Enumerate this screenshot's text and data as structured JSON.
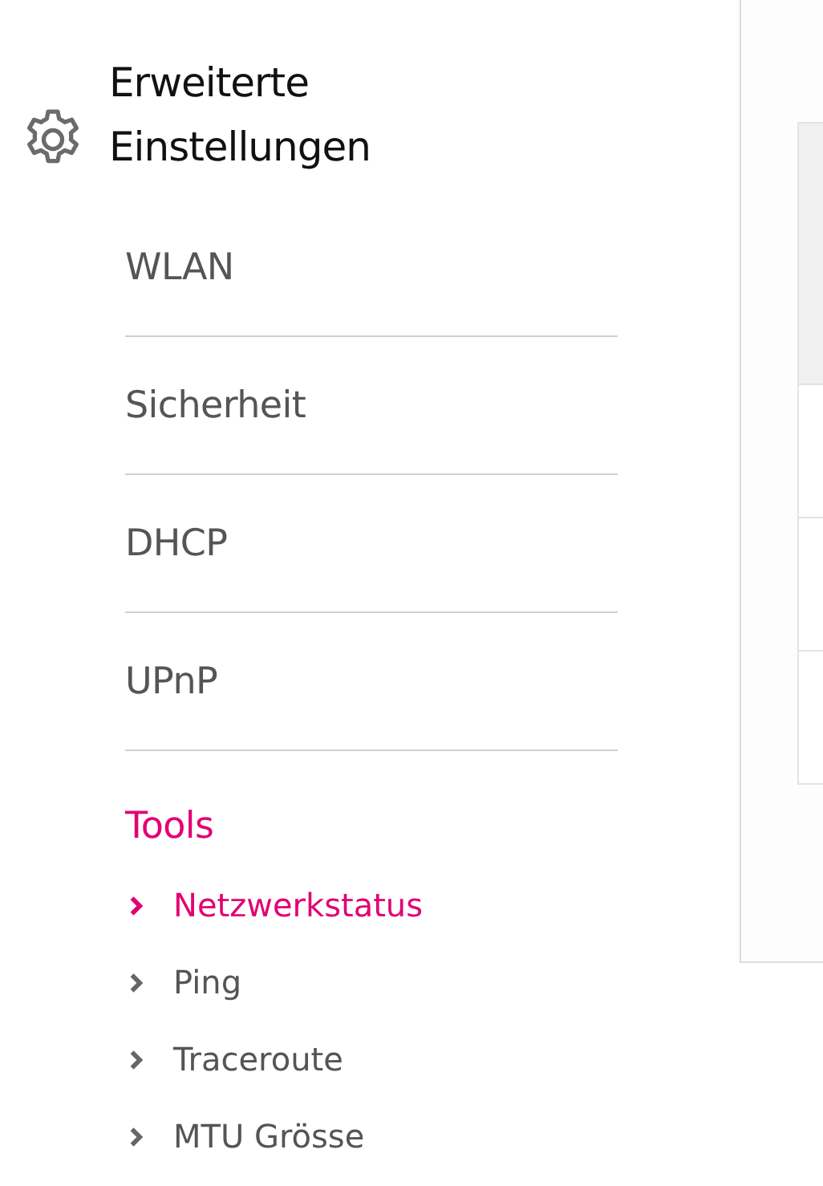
{
  "sidebar": {
    "title_line_1": "Erweiterte",
    "title_line_2": "Einstellungen",
    "items": [
      {
        "label": "WLAN"
      },
      {
        "label": "Sicherheit"
      },
      {
        "label": "DHCP"
      },
      {
        "label": "UPnP"
      }
    ],
    "tools": {
      "heading": "Tools",
      "items": [
        {
          "label": "Netzwerkstatus",
          "selected": true
        },
        {
          "label": "Ping",
          "selected": false
        },
        {
          "label": "Traceroute",
          "selected": false
        },
        {
          "label": "MTU Grösse",
          "selected": false
        }
      ]
    }
  }
}
